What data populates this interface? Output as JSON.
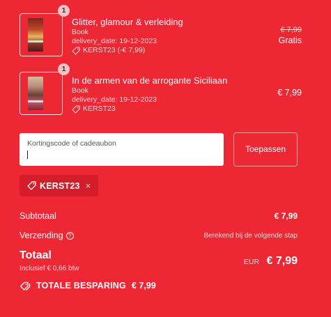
{
  "cart": {
    "items": [
      {
        "quantity": "1",
        "title": "Glitter, glamour & verleiding",
        "type": "Book",
        "delivery": "delivery_date: 19-12-2023",
        "discount": "KERST23 (-€ 7,99)",
        "old_price": "€ 7,99",
        "price": "Gratis"
      },
      {
        "quantity": "1",
        "title": "In de armen van de arrogante Siciliaan",
        "type": "Book",
        "delivery": "delivery_date: 19-12-2023",
        "discount": "KERST23",
        "price": "€ 7,99"
      }
    ]
  },
  "discount_form": {
    "placeholder": "Kortingscode of cadeaubon",
    "value": "",
    "apply_label": "Toepassen"
  },
  "applied_code": {
    "code": "KERST23",
    "remove_icon": "×"
  },
  "summary": {
    "subtotal_label": "Subtotaal",
    "subtotal_value": "€ 7,99",
    "shipping_label": "Verzending",
    "shipping_value": "Berekend bij de volgende stap",
    "help_icon": "?",
    "total_label": "Totaal",
    "tax_note": "Inclusief € 0,66 btw",
    "currency": "EUR",
    "total_value": "€ 7,99",
    "savings_label": "TOTALE BESPARING",
    "savings_value": "€ 7,99"
  },
  "icons": {
    "tag": "tag-icon",
    "tags": "tags-icon",
    "help": "help-circle-icon",
    "close": "close-icon"
  },
  "colors": {
    "background": "#ee2735",
    "chip_background": "#d51c2a",
    "text": "#ffffff",
    "muted_text": "#fbd6d9"
  }
}
